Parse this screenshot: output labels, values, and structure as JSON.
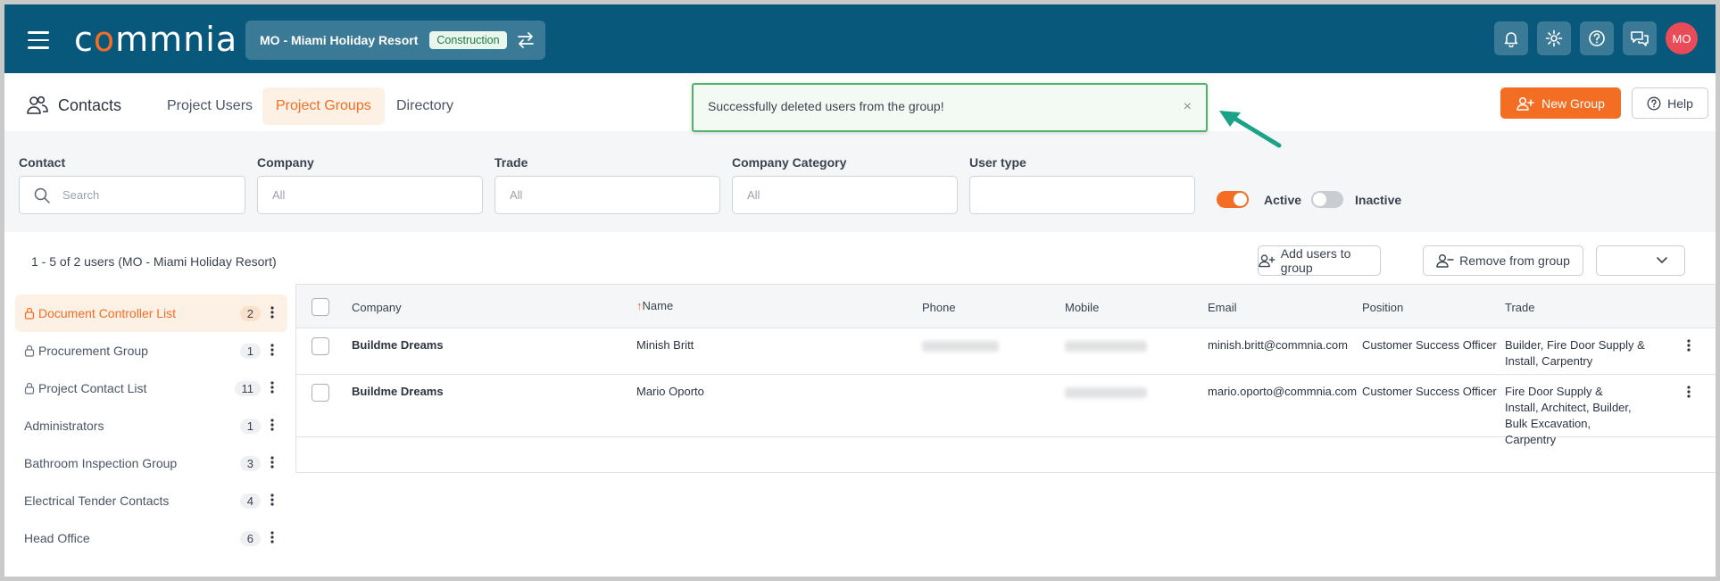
{
  "header": {
    "logo_text": "commnia",
    "project_name": "MO - Miami Holiday Resort",
    "project_badge": "Construction",
    "avatar_initials": "MO"
  },
  "nav": {
    "title": "Contacts",
    "tabs": [
      {
        "label": "Project Users"
      },
      {
        "label": "Project Groups",
        "active": true
      },
      {
        "label": "Directory"
      }
    ],
    "new_group_label": "New Group",
    "help_label": "Help"
  },
  "toast": {
    "message": "Successfully deleted users from the group!",
    "close": "×"
  },
  "filters": {
    "contact_label": "Contact",
    "contact_placeholder": "Search",
    "company_label": "Company",
    "company_value": "All",
    "trade_label": "Trade",
    "trade_value": "All",
    "category_label": "Company Category",
    "category_value": "All",
    "usertype_label": "User type",
    "active_label": "Active",
    "inactive_label": "Inactive"
  },
  "toolbar": {
    "count_text": "1 - 5 of 2 users (MO - Miami Holiday Resort)",
    "add_users_label": "Add users to group",
    "remove_label": "Remove from group"
  },
  "groups": [
    {
      "name": "Document Controller List",
      "count": "2",
      "locked": true,
      "active": true
    },
    {
      "name": "Procurement Group",
      "count": "1",
      "locked": true
    },
    {
      "name": "Project Contact List",
      "count": "11",
      "locked": true
    },
    {
      "name": "Administrators",
      "count": "1"
    },
    {
      "name": "Bathroom Inspection Group",
      "count": "3"
    },
    {
      "name": "Electrical Tender Contacts",
      "count": "4"
    },
    {
      "name": "Head Office",
      "count": "6"
    }
  ],
  "table": {
    "columns": {
      "company": "Company",
      "name": "Name",
      "name_sort": "↑",
      "phone": "Phone",
      "mobile": "Mobile",
      "email": "Email",
      "position": "Position",
      "trade": "Trade"
    },
    "rows": [
      {
        "company": "Buildme Dreams",
        "name": "Minish Britt",
        "email": "minish.britt@commnia.com",
        "position": "Customer Success Officer",
        "trade": "Builder, Fire Door Supply & Install, Carpentry"
      },
      {
        "company": "Buildme Dreams",
        "name": "Mario Oporto",
        "email": "mario.oporto@commnia.com",
        "position": "Customer Success Officer",
        "trade": "Fire Door Supply & Install, Architect, Builder, Bulk Excavation, Carpentry"
      }
    ]
  },
  "colors": {
    "topbar": "#07587a",
    "accent": "#f36e23",
    "toast_border": "#4fb36c",
    "arrow": "#1aa386"
  }
}
